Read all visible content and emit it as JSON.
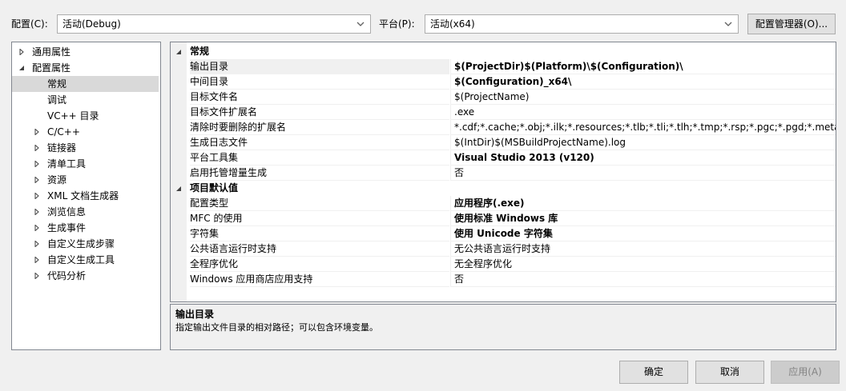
{
  "config": {
    "label": "配置(C):",
    "value": "活动(Debug)"
  },
  "platform": {
    "label": "平台(P):",
    "value": "活动(x64)"
  },
  "config_manager_label": "配置管理器(O)...",
  "tree": [
    {
      "label": "通用属性",
      "level": 0,
      "expander": "collapsed"
    },
    {
      "label": "配置属性",
      "level": 0,
      "expander": "expanded"
    },
    {
      "label": "常规",
      "level": 1,
      "expander": "none",
      "selected": true
    },
    {
      "label": "调试",
      "level": 1,
      "expander": "none"
    },
    {
      "label": "VC++ 目录",
      "level": 1,
      "expander": "none"
    },
    {
      "label": "C/C++",
      "level": 1,
      "expander": "collapsed"
    },
    {
      "label": "链接器",
      "level": 1,
      "expander": "collapsed"
    },
    {
      "label": "清单工具",
      "level": 1,
      "expander": "collapsed"
    },
    {
      "label": "资源",
      "level": 1,
      "expander": "collapsed"
    },
    {
      "label": "XML 文档生成器",
      "level": 1,
      "expander": "collapsed"
    },
    {
      "label": "浏览信息",
      "level": 1,
      "expander": "collapsed"
    },
    {
      "label": "生成事件",
      "level": 1,
      "expander": "collapsed"
    },
    {
      "label": "自定义生成步骤",
      "level": 1,
      "expander": "collapsed"
    },
    {
      "label": "自定义生成工具",
      "level": 1,
      "expander": "collapsed"
    },
    {
      "label": "代码分析",
      "level": 1,
      "expander": "collapsed"
    }
  ],
  "sections": [
    {
      "title": "常规",
      "rows": [
        {
          "name": "输出目录",
          "value": "$(ProjectDir)$(Platform)\\$(Configuration)\\",
          "bold": true,
          "selected": true
        },
        {
          "name": "中间目录",
          "value": "$(Configuration)_x64\\",
          "bold": true
        },
        {
          "name": "目标文件名",
          "value": "$(ProjectName)",
          "bold": false
        },
        {
          "name": "目标文件扩展名",
          "value": ".exe",
          "bold": false
        },
        {
          "name": "清除时要删除的扩展名",
          "value": "*.cdf;*.cache;*.obj;*.ilk;*.resources;*.tlb;*.tli;*.tlh;*.tmp;*.rsp;*.pgc;*.pgd;*.meta;*.tlog;*",
          "bold": false
        },
        {
          "name": "生成日志文件",
          "value": "$(IntDir)$(MSBuildProjectName).log",
          "bold": false
        },
        {
          "name": "平台工具集",
          "value": "Visual Studio 2013 (v120)",
          "bold": true
        },
        {
          "name": "启用托管增量生成",
          "value": "否",
          "bold": false
        }
      ]
    },
    {
      "title": "项目默认值",
      "rows": [
        {
          "name": "配置类型",
          "value": "应用程序(.exe)",
          "bold": true
        },
        {
          "name": "MFC 的使用",
          "value": "使用标准 Windows 库",
          "bold": true
        },
        {
          "name": "字符集",
          "value": "使用 Unicode 字符集",
          "bold": true
        },
        {
          "name": "公共语言运行时支持",
          "value": "无公共语言运行时支持",
          "bold": false
        },
        {
          "name": "全程序优化",
          "value": "无全程序优化",
          "bold": false
        },
        {
          "name": "Windows 应用商店应用支持",
          "value": "否",
          "bold": false
        }
      ]
    }
  ],
  "description": {
    "title": "输出目录",
    "text": "指定输出文件目录的相对路径；可以包含环境变量。"
  },
  "buttons": {
    "ok": "确定",
    "cancel": "取消",
    "apply": "应用(A)"
  }
}
